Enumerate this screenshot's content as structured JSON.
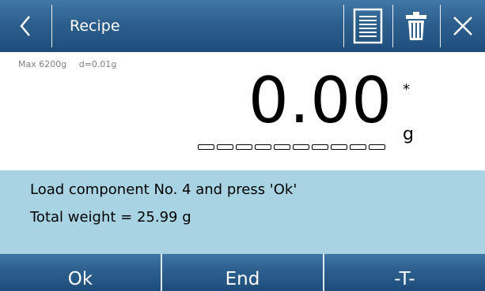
{
  "header": {
    "title": "Recipe",
    "back_icon": "chevron-left-icon",
    "list_icon": "list-document-icon",
    "trash_icon": "trash-icon",
    "close_icon": "close-icon"
  },
  "scale": {
    "max": "Max 6200g",
    "division": "d=0.01g",
    "weight": "0.00",
    "unit": "g",
    "stability_mark": "*"
  },
  "message": {
    "line1": "Load component No. 4 and press 'Ok'",
    "line2": "Total weight = 25.99 g"
  },
  "footer": {
    "ok": "Ok",
    "end": "End",
    "tare": "-T-"
  },
  "colors": {
    "header_bg": "#2d5f8d",
    "message_bg": "#a7d3e3"
  }
}
